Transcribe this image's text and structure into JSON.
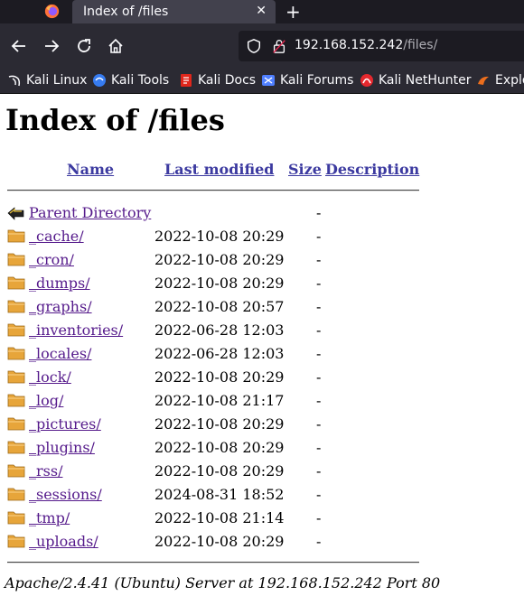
{
  "browser": {
    "tab_title": "Index of /files",
    "close_glyph": "✕",
    "newtab_glyph": "+",
    "url_host": "192.168.152.242",
    "url_path": "/files/",
    "bookmarks": [
      {
        "label": "Kali Linux",
        "icon": "kali-dragon-icon",
        "color": "#ffffff"
      },
      {
        "label": "Kali Tools",
        "icon": "kali-tools-icon",
        "color": "#367bf0"
      },
      {
        "label": "Kali Docs",
        "icon": "kali-docs-icon",
        "color": "#e0261b"
      },
      {
        "label": "Kali Forums",
        "icon": "kali-forums-icon",
        "color": "#4f7fff"
      },
      {
        "label": "Kali NetHunter",
        "icon": "nethunter-icon",
        "color": "#e5282e"
      },
      {
        "label": "Explo",
        "icon": "exploit-db-icon",
        "color": "#ec6e1d"
      }
    ]
  },
  "page": {
    "title": "Index of /files",
    "columns": {
      "name": "Name",
      "modified": "Last modified",
      "size": "Size",
      "description": "Description"
    },
    "parent": {
      "name": "Parent Directory",
      "size": "-"
    },
    "entries": [
      {
        "name": "_cache/",
        "modified": "2022-10-08 20:29",
        "size": "-"
      },
      {
        "name": "_cron/",
        "modified": "2022-10-08 20:29",
        "size": "-"
      },
      {
        "name": "_dumps/",
        "modified": "2022-10-08 20:29",
        "size": "-"
      },
      {
        "name": "_graphs/",
        "modified": "2022-10-08 20:57",
        "size": "-"
      },
      {
        "name": "_inventories/",
        "modified": "2022-06-28 12:03",
        "size": "-"
      },
      {
        "name": "_locales/",
        "modified": "2022-06-28 12:03",
        "size": "-"
      },
      {
        "name": "_lock/",
        "modified": "2022-10-08 20:29",
        "size": "-"
      },
      {
        "name": "_log/",
        "modified": "2022-10-08 21:17",
        "size": "-"
      },
      {
        "name": "_pictures/",
        "modified": "2022-10-08 20:29",
        "size": "-"
      },
      {
        "name": "_plugins/",
        "modified": "2022-10-08 20:29",
        "size": "-"
      },
      {
        "name": "_rss/",
        "modified": "2022-10-08 20:29",
        "size": "-"
      },
      {
        "name": "_sessions/",
        "modified": "2024-08-31 18:52",
        "size": "-"
      },
      {
        "name": "_tmp/",
        "modified": "2022-10-08 21:14",
        "size": "-"
      },
      {
        "name": "_uploads/",
        "modified": "2022-10-08 20:29",
        "size": "-"
      }
    ],
    "footer": "Apache/2.4.41 (Ubuntu) Server at 192.168.152.242 Port 80"
  }
}
